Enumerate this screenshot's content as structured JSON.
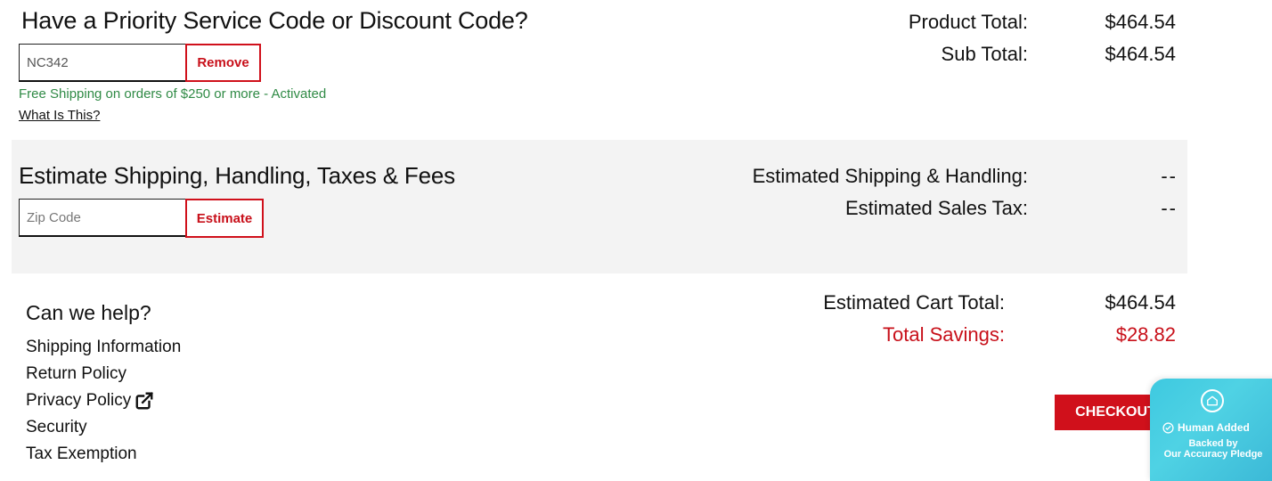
{
  "promo": {
    "heading": "Have a Priority Service Code or Discount Code?",
    "code_value": "NC342",
    "remove_label": "Remove",
    "activated_text": "Free Shipping on orders of $250 or more - Activated",
    "what_is_this": "What Is This?"
  },
  "totals": {
    "product_total_label": "Product Total:",
    "product_total_value": "$464.54",
    "sub_total_label": "Sub Total:",
    "sub_total_value": "$464.54"
  },
  "estimate": {
    "heading": "Estimate Shipping, Handling, Taxes & Fees",
    "zip_placeholder": "Zip Code",
    "estimate_label": "Estimate",
    "shipping_label": "Estimated Shipping & Handling:",
    "shipping_value": "--",
    "tax_label": "Estimated Sales Tax:",
    "tax_value": "--"
  },
  "cart": {
    "estimated_total_label": "Estimated Cart Total:",
    "estimated_total_value": "$464.54",
    "savings_label": "Total Savings:",
    "savings_value": "$28.82",
    "checkout_label": "CHECKOUT"
  },
  "help": {
    "heading": "Can we help?",
    "links": [
      "Shipping Information",
      "Return Policy",
      "Privacy Policy",
      "Security",
      "Tax Exemption"
    ]
  },
  "badge": {
    "title": "Human Added",
    "subtitle_line1": "Backed by",
    "subtitle_line2": "Our Accuracy Pledge"
  },
  "icons": {
    "external_link": "external-link-icon",
    "check": "check-circle-icon",
    "badge_logo": "shield-home-icon"
  },
  "colors": {
    "brand_red": "#d0101b",
    "success_green": "#2f8a45",
    "panel_gray": "#f3f3f3",
    "badge_teal": "#3ec9e0"
  }
}
